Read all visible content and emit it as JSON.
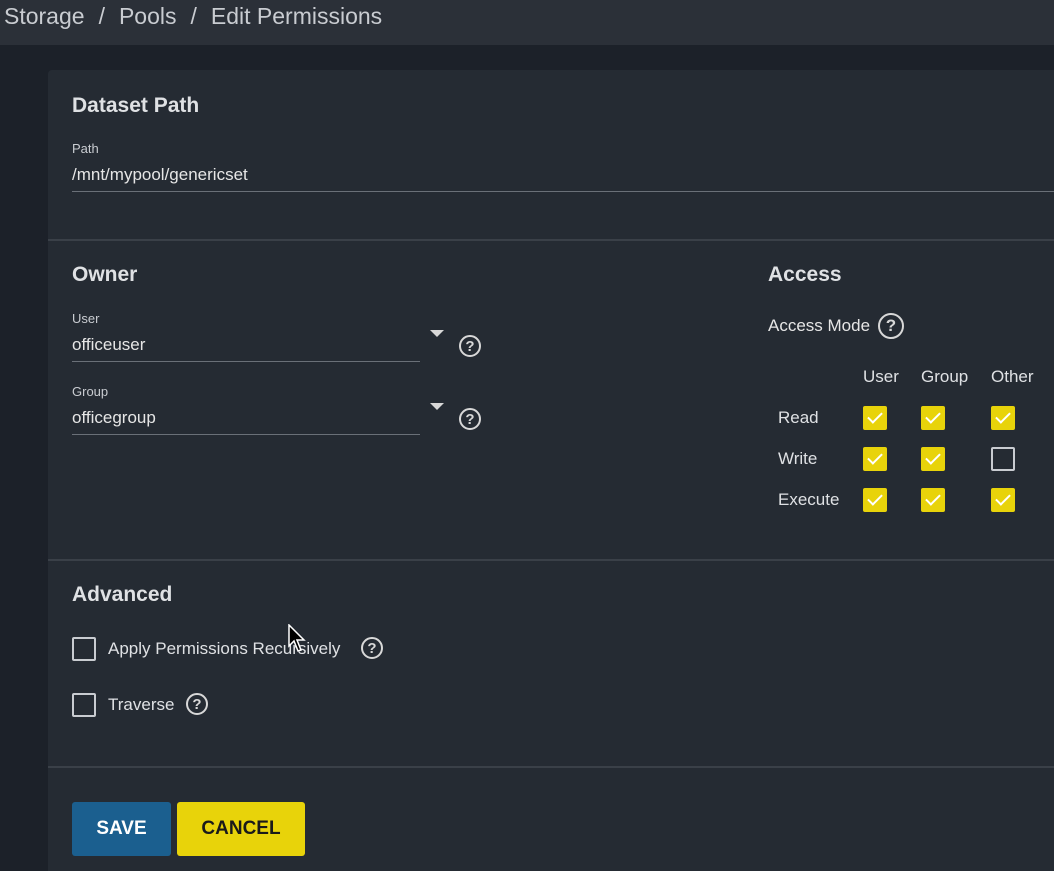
{
  "breadcrumb": [
    "Storage",
    "Pools",
    "Edit Permissions"
  ],
  "dataset": {
    "title": "Dataset Path",
    "path_label": "Path",
    "path_value": "/mnt/mypool/genericset"
  },
  "owner": {
    "title": "Owner",
    "user_label": "User",
    "user_value": "officeuser",
    "group_label": "Group",
    "group_value": "officegroup"
  },
  "access": {
    "title": "Access",
    "mode_label": "Access Mode",
    "columns": [
      "User",
      "Group",
      "Other"
    ],
    "rows": [
      {
        "label": "Read",
        "values": [
          true,
          true,
          true
        ]
      },
      {
        "label": "Write",
        "values": [
          true,
          true,
          false
        ]
      },
      {
        "label": "Execute",
        "values": [
          true,
          true,
          true
        ]
      }
    ]
  },
  "advanced": {
    "title": "Advanced",
    "recursive_label": "Apply Permissions Recursively",
    "recursive_checked": false,
    "traverse_label": "Traverse",
    "traverse_checked": false
  },
  "actions": {
    "save_label": "SAVE",
    "cancel_label": "CANCEL"
  },
  "icons": {
    "help": "help-circle-icon",
    "caret": "caret-down-icon",
    "cursor": "mouse-cursor-icon"
  },
  "colors": {
    "accent_yellow": "#e8d30a",
    "save_blue": "#1b5f8f",
    "card_bg": "#252b33",
    "page_bg": "#1c2129"
  }
}
